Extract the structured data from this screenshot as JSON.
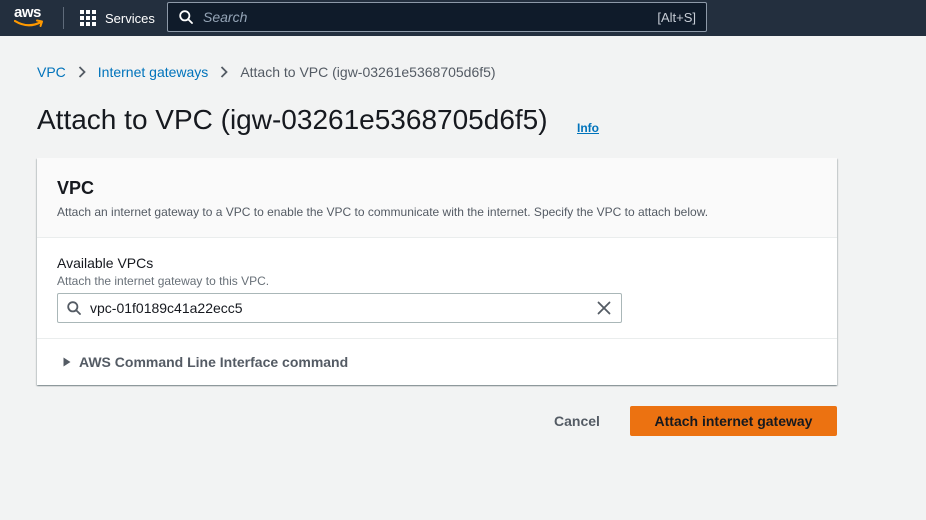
{
  "nav": {
    "logo_text": "aws",
    "services_label": "Services",
    "search_placeholder": "Search",
    "search_shortcut": "[Alt+S]"
  },
  "breadcrumb": [
    {
      "label": "VPC"
    },
    {
      "label": "Internet gateways"
    },
    {
      "label": "Attach to VPC (igw-03261e5368705d6f5)"
    }
  ],
  "page": {
    "title": "Attach to VPC (igw-03261e5368705d6f5)",
    "info_label": "Info"
  },
  "panel": {
    "title": "VPC",
    "description": "Attach an internet gateway to a VPC to enable the VPC to communicate with the internet. Specify the VPC to attach below.",
    "field_label": "Available VPCs",
    "field_description": "Attach the internet gateway to this VPC.",
    "field_value": "vpc-01f0189c41a22ecc5",
    "expander_label": "AWS Command Line Interface command"
  },
  "actions": {
    "cancel_label": "Cancel",
    "primary_label": "Attach internet gateway"
  },
  "icons": {
    "logo": "aws-logo-icon",
    "services": "grid-icon",
    "search": "search-icon",
    "breadcrumb_separator": "chevron-right-icon",
    "clear": "close-icon",
    "expander": "caret-right-icon"
  },
  "colors": {
    "nav_background": "#232f3e",
    "link": "#0073bb",
    "primary_button": "#ec7211",
    "page_background": "#f2f3f3"
  }
}
